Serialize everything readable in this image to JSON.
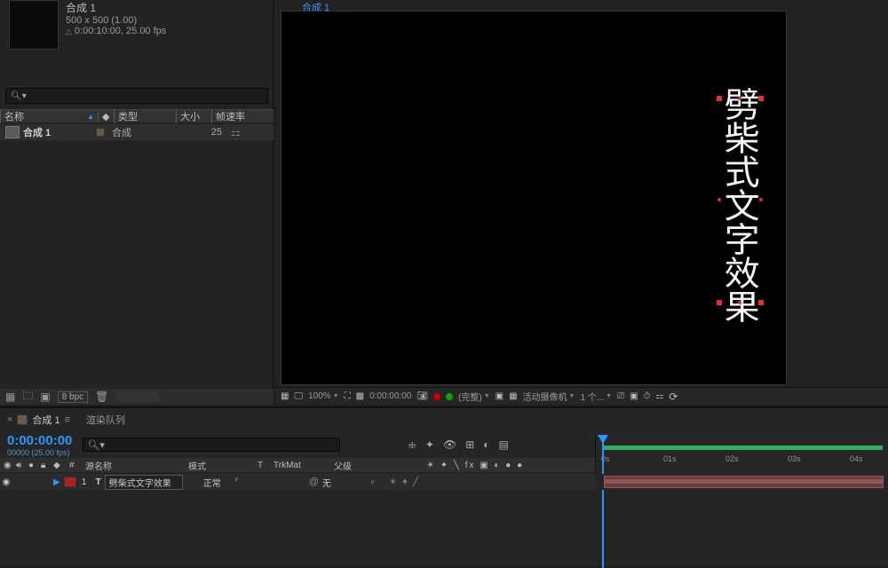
{
  "project": {
    "comp_name": "合成 1",
    "dims": "500 x 500 (1.00)",
    "duration": "0:00:10:00, 25.00 fps",
    "search_placeholder": "",
    "cols": {
      "name": "名称",
      "tag_icon": "◆",
      "type": "类型",
      "size": "大小",
      "fps": "帧速率"
    },
    "row": {
      "name": "合成 1",
      "type": "合成",
      "fps": "25"
    },
    "bpc": "8 bpc"
  },
  "viewer": {
    "tab": "合成 1",
    "text_content": "劈柴式文字效果",
    "footer": {
      "zoom": "100%",
      "time": "0:00:00:00",
      "res": "(完整)",
      "camera": "活动摄像机",
      "views": "1 个..."
    }
  },
  "timeline": {
    "tab1": "合成 1",
    "tab2": "渲染队列",
    "time": "0:00:00:00",
    "subtime": "00000 (25.00 fps)",
    "cols": {
      "index": "#",
      "source": "源名称",
      "mode": "模式",
      "t": "T",
      "trkmat": "TrkMat",
      "parent": "父级"
    },
    "layer": {
      "num": "1",
      "type_icon": "T",
      "name": "劈柴式文字效果",
      "mode": "正常",
      "parent": "无"
    },
    "ruler": {
      "marks": [
        "0s",
        "01s",
        "02s",
        "03s",
        "04s"
      ]
    }
  }
}
